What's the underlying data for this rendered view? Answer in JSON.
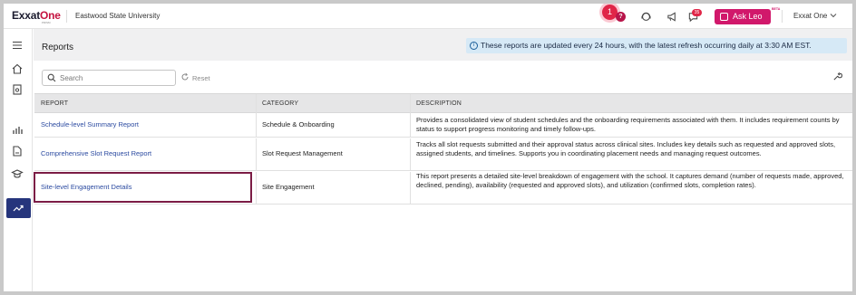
{
  "header": {
    "logo_text": "Exxat",
    "logo_accent": "One",
    "logo_sub": "PRISM",
    "institution": "Eastwood State University",
    "help_label": "?",
    "step_number": "1",
    "notification_count": "35",
    "ask_leo_label": "Ask Leo",
    "beta_label": "BETA",
    "user_menu_label": "Exxat One"
  },
  "page": {
    "title": "Reports",
    "info_text": "These reports are updated every 24 hours, with the latest refresh occurring daily at 3:30 AM EST."
  },
  "toolbar": {
    "search_placeholder": "Search",
    "search_value": "",
    "reset_label": "Reset"
  },
  "table": {
    "columns": [
      "REPORT",
      "CATEGORY",
      "DESCRIPTION"
    ],
    "rows": [
      {
        "report": "Schedule-level Summary Report",
        "category": "Schedule & Onboarding",
        "description": "Provides a consolidated view of student schedules and the onboarding requirements associated with them. It includes requirement counts by status to support progress monitoring and timely follow-ups."
      },
      {
        "report": "Comprehensive Slot Request Report",
        "category": "Slot Request Management",
        "description": "Tracks all slot requests submitted and their approval status across clinical sites. Includes key details such as requested and approved slots, assigned students, and timelines. Supports you in coordinating placement needs and managing request outcomes."
      },
      {
        "report": "Site-level Engagement Details",
        "category": "Site Engagement",
        "description": "This report presents a detailed site-level breakdown of engagement with the school. It captures demand (number of requests made, approved, declined, pending), availability (requested and approved slots), and utilization (confirmed slots, completion rates)."
      }
    ]
  },
  "colors": {
    "brand": "#c4123f",
    "ask_leo": "#d1186b",
    "nav_active": "#26357c",
    "link": "#2b4aa0",
    "highlight_border": "#7b1c45",
    "info_bg": "#d6e9f6"
  }
}
